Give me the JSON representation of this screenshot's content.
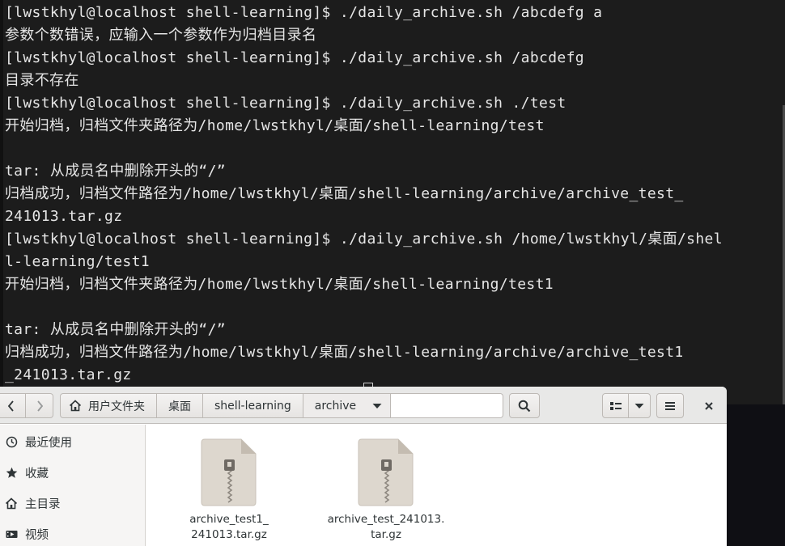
{
  "terminal": {
    "lines": [
      "[lwstkhyl@localhost shell-learning]$ ./daily_archive.sh /abcdefg a",
      "参数个数错误，应输入一个参数作为归档目录名",
      "[lwstkhyl@localhost shell-learning]$ ./daily_archive.sh /abcdefg",
      "目录不存在",
      "[lwstkhyl@localhost shell-learning]$ ./daily_archive.sh ./test",
      "开始归档，归档文件夹路径为/home/lwstkhyl/桌面/shell-learning/test",
      "",
      "tar: 从成员名中删除开头的“/”",
      "归档成功，归档文件路径为/home/lwstkhyl/桌面/shell-learning/archive/archive_test_",
      "241013.tar.gz",
      "[lwstkhyl@localhost shell-learning]$ ./daily_archive.sh /home/lwstkhyl/桌面/shel",
      "l-learning/test1",
      "开始归档，归档文件夹路径为/home/lwstkhyl/桌面/shell-learning/test1",
      "",
      "tar: 从成员名中删除开头的“/”",
      "归档成功，归档文件路径为/home/lwstkhyl/桌面/shell-learning/archive/archive_test1",
      "_241013.tar.gz"
    ]
  },
  "file_manager": {
    "breadcrumbs": [
      "用户文件夹",
      "桌面",
      "shell-learning",
      "archive"
    ],
    "sidebar": [
      {
        "label": "最近使用",
        "icon": "clock-icon"
      },
      {
        "label": "收藏",
        "icon": "star-icon"
      },
      {
        "label": "主目录",
        "icon": "home-icon"
      },
      {
        "label": "视频",
        "icon": "video-icon"
      }
    ],
    "files": [
      {
        "label": "archive_test1_\n241013.tar.gz",
        "icon": "zip-archive-icon"
      },
      {
        "label": "archive_test_241013.\ntar.gz",
        "icon": "zip-archive-icon"
      }
    ]
  },
  "colors": {
    "terminal_bg": "#1c1c1c",
    "terminal_fg": "#e6e6e6",
    "headerbar_bg": "#e8e8e7",
    "sidebar_bg": "#f6f5f4"
  }
}
